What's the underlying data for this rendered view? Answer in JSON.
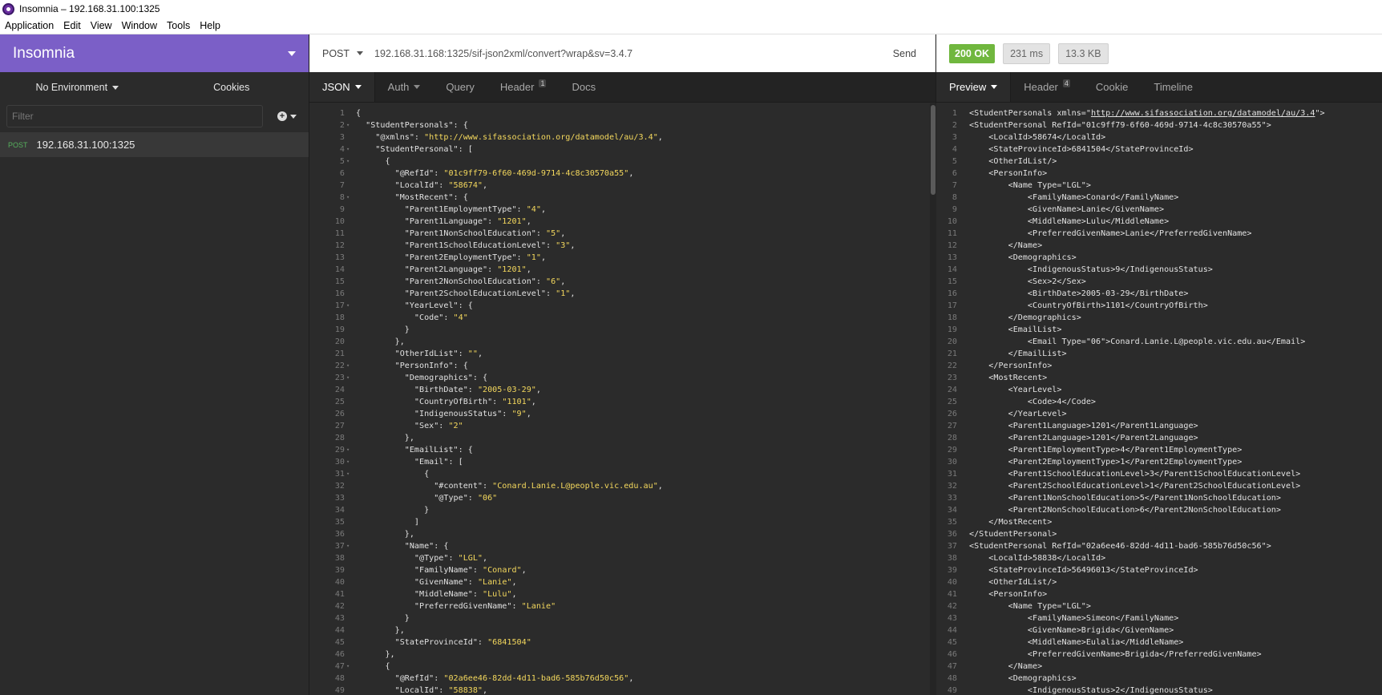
{
  "window": {
    "title": "Insomnia – 192.168.31.100:1325"
  },
  "menu": [
    "Application",
    "Edit",
    "View",
    "Window",
    "Tools",
    "Help"
  ],
  "sidebar": {
    "workspace": "Insomnia",
    "environment": "No Environment",
    "cookies": "Cookies",
    "filter_placeholder": "Filter",
    "request": {
      "method": "POST",
      "name": "192.168.31.100:1325"
    }
  },
  "request": {
    "method": "POST",
    "url": "192.168.31.168:1325/sif-json2xml/convert?wrap&sv=3.4.7",
    "send": "Send",
    "tabs": {
      "body": "JSON",
      "auth": "Auth",
      "query": "Query",
      "header": "Header",
      "header_count": "1",
      "docs": "Docs"
    },
    "body_lines": [
      "{",
      "  \"StudentPersonals\": {",
      "    \"@xmlns\": \"http://www.sifassociation.org/datamodel/au/3.4\",",
      "    \"StudentPersonal\": [",
      "      {",
      "        \"@RefId\": \"01c9ff79-6f60-469d-9714-4c8c30570a55\",",
      "        \"LocalId\": \"58674\",",
      "        \"MostRecent\": {",
      "          \"Parent1EmploymentType\": \"4\",",
      "          \"Parent1Language\": \"1201\",",
      "          \"Parent1NonSchoolEducation\": \"5\",",
      "          \"Parent1SchoolEducationLevel\": \"3\",",
      "          \"Parent2EmploymentType\": \"1\",",
      "          \"Parent2Language\": \"1201\",",
      "          \"Parent2NonSchoolEducation\": \"6\",",
      "          \"Parent2SchoolEducationLevel\": \"1\",",
      "          \"YearLevel\": {",
      "            \"Code\": \"4\"",
      "          }",
      "        },",
      "        \"OtherIdList\": \"\",",
      "        \"PersonInfo\": {",
      "          \"Demographics\": {",
      "            \"BirthDate\": \"2005-03-29\",",
      "            \"CountryOfBirth\": \"1101\",",
      "            \"IndigenousStatus\": \"9\",",
      "            \"Sex\": \"2\"",
      "          },",
      "          \"EmailList\": {",
      "            \"Email\": [",
      "              {",
      "                \"#content\": \"Conard.Lanie.L@people.vic.edu.au\",",
      "                \"@Type\": \"06\"",
      "              }",
      "            ]",
      "          },",
      "          \"Name\": {",
      "            \"@Type\": \"LGL\",",
      "            \"FamilyName\": \"Conard\",",
      "            \"GivenName\": \"Lanie\",",
      "            \"MiddleName\": \"Lulu\",",
      "            \"PreferredGivenName\": \"Lanie\"",
      "          }",
      "        },",
      "        \"StateProvinceId\": \"6841504\"",
      "      },",
      "      {",
      "        \"@RefId\": \"02a6ee46-82dd-4d11-bad6-585b76d50c56\",",
      "        \"LocalId\": \"58838\","
    ],
    "body_fold_lines": [
      2,
      4,
      5,
      8,
      17,
      22,
      23,
      29,
      30,
      31,
      37,
      47
    ]
  },
  "response": {
    "status": "200 OK",
    "time": "231 ms",
    "size": "13.3 KB",
    "tabs": {
      "preview": "Preview",
      "header": "Header",
      "header_count": "4",
      "cookie": "Cookie",
      "timeline": "Timeline"
    },
    "body_lines": [
      "<StudentPersonals xmlns=\"http://www.sifassociation.org/datamodel/au/3.4\">",
      "<StudentPersonal RefId=\"01c9ff79-6f60-469d-9714-4c8c30570a55\">",
      "    <LocalId>58674</LocalId>",
      "    <StateProvinceId>6841504</StateProvinceId>",
      "    <OtherIdList/>",
      "    <PersonInfo>",
      "        <Name Type=\"LGL\">",
      "            <FamilyName>Conard</FamilyName>",
      "            <GivenName>Lanie</GivenName>",
      "            <MiddleName>Lulu</MiddleName>",
      "            <PreferredGivenName>Lanie</PreferredGivenName>",
      "        </Name>",
      "        <Demographics>",
      "            <IndigenousStatus>9</IndigenousStatus>",
      "            <Sex>2</Sex>",
      "            <BirthDate>2005-03-29</BirthDate>",
      "            <CountryOfBirth>1101</CountryOfBirth>",
      "        </Demographics>",
      "        <EmailList>",
      "            <Email Type=\"06\">Conard.Lanie.L@people.vic.edu.au</Email>",
      "        </EmailList>",
      "    </PersonInfo>",
      "    <MostRecent>",
      "        <YearLevel>",
      "            <Code>4</Code>",
      "        </YearLevel>",
      "        <Parent1Language>1201</Parent1Language>",
      "        <Parent2Language>1201</Parent2Language>",
      "        <Parent1EmploymentType>4</Parent1EmploymentType>",
      "        <Parent2EmploymentType>1</Parent2EmploymentType>",
      "        <Parent1SchoolEducationLevel>3</Parent1SchoolEducationLevel>",
      "        <Parent2SchoolEducationLevel>1</Parent2SchoolEducationLevel>",
      "        <Parent1NonSchoolEducation>5</Parent1NonSchoolEducation>",
      "        <Parent2NonSchoolEducation>6</Parent2NonSchoolEducation>",
      "    </MostRecent>",
      "</StudentPersonal>",
      "<StudentPersonal RefId=\"02a6ee46-82dd-4d11-bad6-585b76d50c56\">",
      "    <LocalId>58838</LocalId>",
      "    <StateProvinceId>56496013</StateProvinceId>",
      "    <OtherIdList/>",
      "    <PersonInfo>",
      "        <Name Type=\"LGL\">",
      "            <FamilyName>Simeon</FamilyName>",
      "            <GivenName>Brigida</GivenName>",
      "            <MiddleName>Eulalia</MiddleName>",
      "            <PreferredGivenName>Brigida</PreferredGivenName>",
      "        </Name>",
      "        <Demographics>",
      "            <IndigenousStatus>2</IndigenousStatus>"
    ]
  },
  "colors": {
    "accent": "#7b5fc7",
    "status_ok": "#70b73e",
    "json_string": "#f4d85d",
    "method_post": "#56b05d"
  },
  "icons": [
    "app-icon",
    "workspace-caret-icon",
    "environment-caret-icon",
    "add-icon",
    "method-caret-icon",
    "fold-arrow-icon",
    "scrollbar"
  ]
}
